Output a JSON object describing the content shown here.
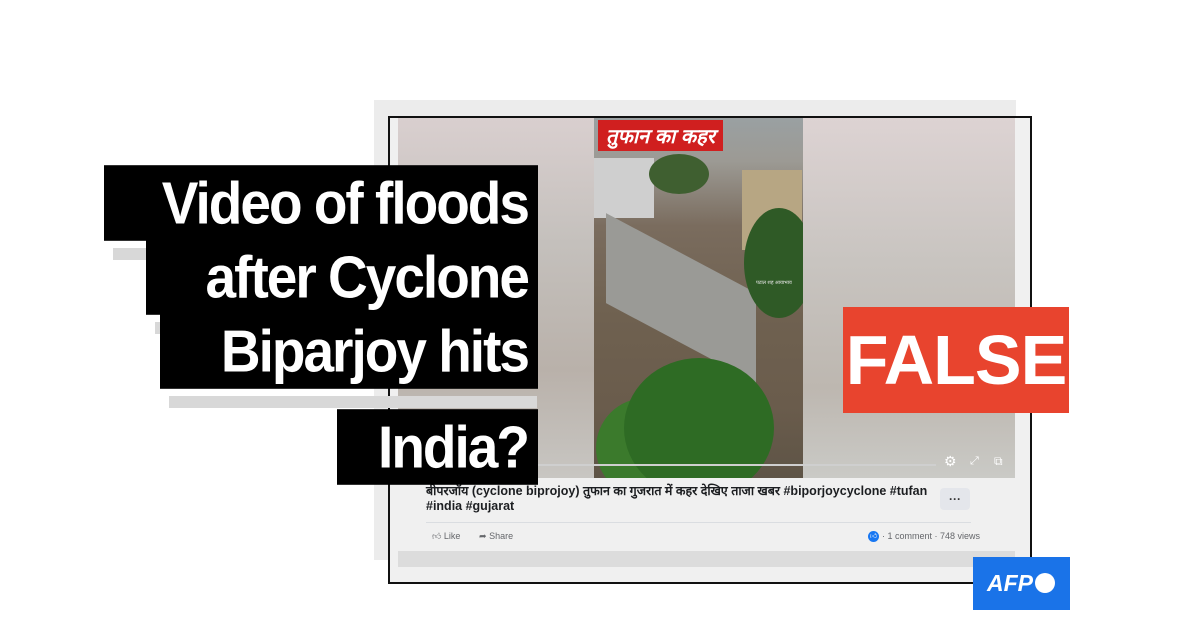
{
  "headline": {
    "lines": [
      "Video of floods",
      "after Cyclone",
      "Biparjoy hits",
      "India?"
    ]
  },
  "verdict": {
    "label": "FALSE",
    "color": "#e8442e"
  },
  "logo": {
    "text": "AFP",
    "color": "#1a73e8"
  },
  "post": {
    "video_overlay_text": "तुफान का कहर",
    "watermark": "पटाल शह आयाभाव",
    "caption": "बीपरजॉय (cyclone biprojoy) तुफान का गुजरात में कहर देखिए ताजा खबर #biporjoycyclone #tufan #india #gujarat",
    "more_label": "···",
    "actions": {
      "like": "Like",
      "share": "Share"
    },
    "stats": "· 1 comment · 748 views"
  }
}
